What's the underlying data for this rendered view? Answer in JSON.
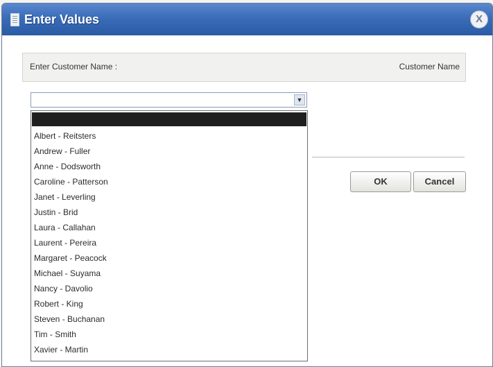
{
  "dialog": {
    "title": "Enter Values",
    "close_glyph": "X",
    "icon": "document-icon"
  },
  "prompt": {
    "label": "Enter Customer Name :",
    "hint": "Customer Name"
  },
  "combo": {
    "value": "",
    "arrow_glyph": "▼"
  },
  "buttons": {
    "ok": "OK",
    "cancel": "Cancel"
  },
  "dropdown": {
    "selected_item": "",
    "items": [
      "Albert - Reitsters",
      "Andrew - Fuller",
      "Anne - Dodsworth",
      "Caroline - Patterson",
      "Janet - Leverling",
      "Justin - Brid",
      "Laura - Callahan",
      "Laurent - Pereira",
      "Margaret - Peacock",
      "Michael - Suyama",
      "Nancy - Davolio",
      "Robert - King",
      "Steven - Buchanan",
      "Tim - Smith",
      "Xavier - Martin"
    ]
  }
}
